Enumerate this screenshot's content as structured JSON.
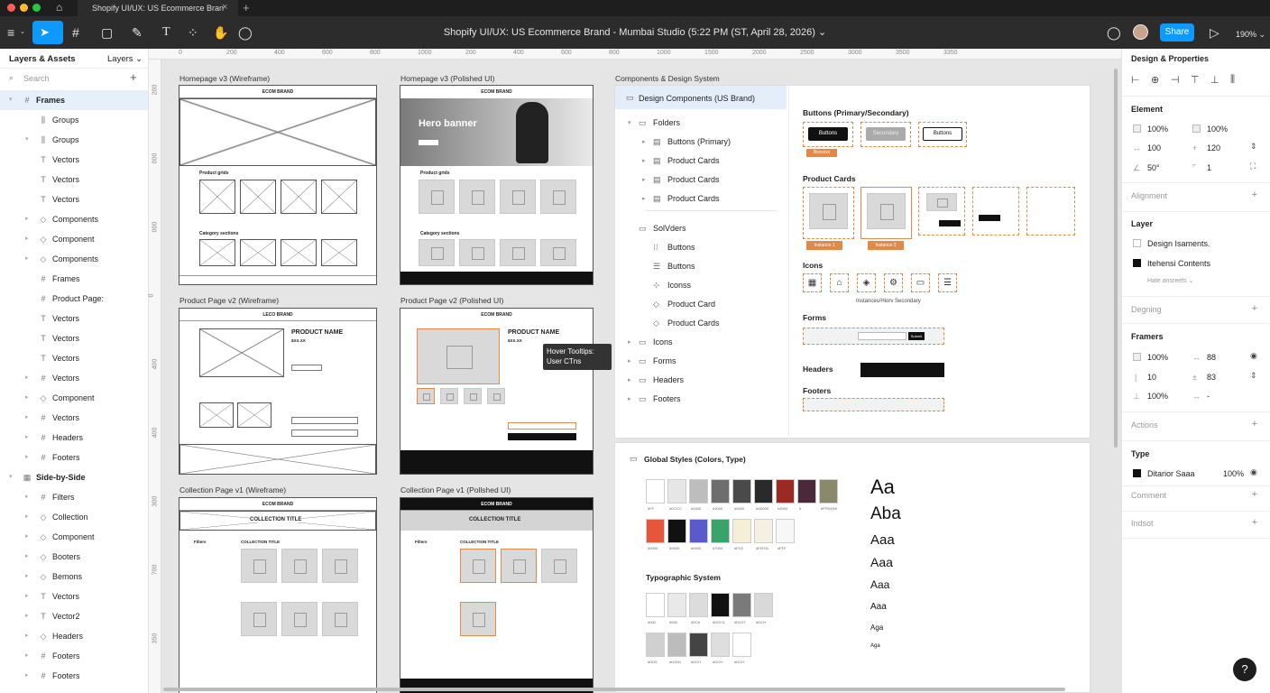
{
  "window": {
    "tab_title": "Shopify UI/UX: US Ecommerce Bran",
    "close": "×",
    "new_tab": "+"
  },
  "toolbar": {
    "doc_title": "Shopify UI/UX: US Ecommerce Brand - Mumbai Studio (5:22 PM (ST, April 28, 2026) ⌄",
    "share_label": "Share",
    "zoom_label": "190% ⌄"
  },
  "left_panel": {
    "tab_layers": "Layers & Assets",
    "tab_pages": "Layers ⌄",
    "search_placeholder": "Search",
    "items": [
      {
        "label": "Frames",
        "icon": "#",
        "indent": 0,
        "arrow": "▾",
        "bold": true
      },
      {
        "label": "Groups",
        "icon": "⫼",
        "indent": 2,
        "arrow": ""
      },
      {
        "label": "Groups",
        "icon": "⫼",
        "indent": 2,
        "arrow": "▾"
      },
      {
        "label": "Vectors",
        "icon": "T",
        "indent": 2,
        "arrow": ""
      },
      {
        "label": "Vectors",
        "icon": "T",
        "indent": 2,
        "arrow": ""
      },
      {
        "label": "Vectors",
        "icon": "T",
        "indent": 2,
        "arrow": ""
      },
      {
        "label": "Components",
        "icon": "◇",
        "indent": 2,
        "arrow": "▸"
      },
      {
        "label": "Component",
        "icon": "◇",
        "indent": 2,
        "arrow": "▸"
      },
      {
        "label": "Components",
        "icon": "◇",
        "indent": 2,
        "arrow": "▸"
      },
      {
        "label": "Frames",
        "icon": "#",
        "indent": 2,
        "arrow": ""
      },
      {
        "label": "Product Page:",
        "icon": "#",
        "indent": 2,
        "arrow": ""
      },
      {
        "label": "Vectors",
        "icon": "T",
        "indent": 2,
        "arrow": ""
      },
      {
        "label": "Vectors",
        "icon": "T",
        "indent": 2,
        "arrow": ""
      },
      {
        "label": "Vectors",
        "icon": "T",
        "indent": 2,
        "arrow": ""
      },
      {
        "label": "Vectors",
        "icon": "#",
        "indent": 2,
        "arrow": "▸"
      },
      {
        "label": "Component",
        "icon": "◇",
        "indent": 2,
        "arrow": "▸"
      },
      {
        "label": "Vectors",
        "icon": "#",
        "indent": 2,
        "arrow": "▸"
      },
      {
        "label": "Headers",
        "icon": "#",
        "indent": 2,
        "arrow": "▸"
      },
      {
        "label": "Footers",
        "icon": "#",
        "indent": 2,
        "arrow": "▸"
      },
      {
        "label": "Side-by-Side",
        "icon": "▦",
        "indent": 0,
        "arrow": "▾",
        "bold": true
      },
      {
        "label": "Filters",
        "icon": "#",
        "indent": 2,
        "arrow": "▸"
      },
      {
        "label": "Collection",
        "icon": "◇",
        "indent": 2,
        "arrow": "▸"
      },
      {
        "label": "Component",
        "icon": "◇",
        "indent": 2,
        "arrow": "▸"
      },
      {
        "label": "Booters",
        "icon": "◇",
        "indent": 2,
        "arrow": "▸"
      },
      {
        "label": "Bemons",
        "icon": "◇",
        "indent": 2,
        "arrow": "▸"
      },
      {
        "label": "Vectors",
        "icon": "T",
        "indent": 2,
        "arrow": "▸"
      },
      {
        "label": "Vector2",
        "icon": "T",
        "indent": 2,
        "arrow": "▸"
      },
      {
        "label": "Headers",
        "icon": "◇",
        "indent": 2,
        "arrow": "▸"
      },
      {
        "label": "Footers",
        "icon": "#",
        "indent": 2,
        "arrow": "▸"
      },
      {
        "label": "Footers",
        "icon": "#",
        "indent": 2,
        "arrow": "▸"
      }
    ]
  },
  "rulers": {
    "top": [
      "0",
      "200",
      "400",
      "600",
      "800",
      "1000",
      "200",
      "400",
      "600",
      "800",
      "1000",
      "1500",
      "2000",
      "2500",
      "3000",
      "3500",
      "3350"
    ],
    "left": [
      "200",
      "000",
      "000",
      "0",
      "400",
      "400",
      "300",
      "700",
      "350"
    ]
  },
  "frames": {
    "hp_wire": "Homepage v3 (Wireframe)",
    "hp_polish": "Homepage v3 (Polished UI)",
    "pp_wire": "Product Page v2 (Wireframe)",
    "pp_polish": "Product Page v2 (Polished UI)",
    "cp_wire": "Collection Page v1 (Wireframe)",
    "cp_polish": "Collection Page v1 (Pollshed UI)",
    "brand_wire": "ECOM BRAND",
    "brand_polish": "ECOM BRAND",
    "brand_pp": "LECO BRAND",
    "brand_ppp": "ECOM BRAND",
    "hero": "Hero banner",
    "grid_wire": "Product grids",
    "grid_polish": "Product grids",
    "cat_wire": "Category sections",
    "cat_polish": "Category sections",
    "product_name": "PRODUCT NAME",
    "price": "$XX.XX",
    "collection_title": "COLLECTION TITLE",
    "filters": "Filters",
    "tooltip": "Hover Tooltips: User CTns"
  },
  "components": {
    "panel_label": "Components & Design System",
    "root": "Design Components (US Brand)",
    "tree": [
      {
        "label": "Folders",
        "depth": 1,
        "arrow": "▾",
        "icon": "▭"
      },
      {
        "label": "Buttons (Primary)",
        "depth": 2,
        "arrow": "▸",
        "icon": "▤"
      },
      {
        "label": "Product Cards",
        "depth": 2,
        "arrow": "▸",
        "icon": "▤"
      },
      {
        "label": "Product Cards",
        "depth": 2,
        "arrow": "▸",
        "icon": "▤"
      },
      {
        "label": "Product Cards",
        "depth": 2,
        "arrow": "▸",
        "icon": "▤"
      },
      {
        "label": "SolVders",
        "depth": 1,
        "arrow": "",
        "icon": "▭"
      },
      {
        "label": "Buttons",
        "depth": 2,
        "arrow": "",
        "icon": "⁝⁝"
      },
      {
        "label": "Buttons",
        "depth": 2,
        "arrow": "",
        "icon": "☰"
      },
      {
        "label": "Iconss",
        "depth": 2,
        "arrow": "",
        "icon": "⊹"
      },
      {
        "label": "Product Card",
        "depth": 2,
        "arrow": "",
        "icon": "◇"
      },
      {
        "label": "Product Cards",
        "depth": 2,
        "arrow": "",
        "icon": "◇"
      },
      {
        "label": "Icons",
        "depth": 1,
        "arrow": "▸",
        "icon": "▭"
      },
      {
        "label": "Forms",
        "depth": 1,
        "arrow": "▸",
        "icon": "▭"
      },
      {
        "label": "Headers",
        "depth": 1,
        "arrow": "▸",
        "icon": "▭"
      },
      {
        "label": "Footers",
        "depth": 1,
        "arrow": "▸",
        "icon": "▭"
      }
    ],
    "buttons_title": "Buttons (Primary/Secondary)",
    "btn_primary": "Buttons",
    "btn_secondary": "Secondary",
    "btn_outline": "Buttons",
    "btn_tag": "Bxxxxxx",
    "cards_title": "Product Cards",
    "instance1": "Instance 1",
    "instance2": "Instance 2",
    "icons_title": "Icons",
    "icons_caption": "Instances/Hiorv Secondary",
    "forms_title": "Forms",
    "forms_btn": "Submit",
    "headers_title": "Headers",
    "footers_title": "Footers"
  },
  "global_styles": {
    "title": "Global Styles (Colors, Type)",
    "row1": [
      {
        "hex": "#ffffff",
        "l": "#FF"
      },
      {
        "hex": "#e6e6e6",
        "l": "#CCCC"
      },
      {
        "hex": "#bdbdbd",
        "l": "#2000"
      },
      {
        "hex": "#6e6e6e",
        "l": "#3000"
      },
      {
        "hex": "#4a4a4a",
        "l": "#0000"
      },
      {
        "hex": "#2a2a2a",
        "l": "#0D000"
      },
      {
        "hex": "#9a2a22",
        "l": "#3000"
      },
      {
        "hex": "#4a2a3a",
        "l": "#"
      },
      {
        "hex": "#8a8a6a",
        "l": "#FF00000"
      }
    ],
    "row2": [
      {
        "hex": "#e4573a",
        "l": "#0000"
      },
      {
        "hex": "#111111",
        "l": "#0000"
      },
      {
        "hex": "#5a5acc",
        "l": "#0000"
      },
      {
        "hex": "#3aa36a",
        "l": "#7000"
      },
      {
        "hex": "#f6efd8",
        "l": "#FCE"
      },
      {
        "hex": "#f5f0e3",
        "l": "#FFF00"
      },
      {
        "hex": "#f7f7f7",
        "l": "#FFF"
      }
    ],
    "typo_title": "Typographic System",
    "row3": [
      {
        "hex": "#ffffff",
        "l": "#000"
      },
      {
        "hex": "#e9e9e9",
        "l": "#000"
      },
      {
        "hex": "#dcdcdc",
        "l": "#DCh"
      },
      {
        "hex": "#111111",
        "l": "#DOC3"
      },
      {
        "hex": "#7a7a7a",
        "l": "#DO27"
      },
      {
        "hex": "#d9d9d9",
        "l": "#DCH"
      }
    ],
    "row4": [
      {
        "hex": "#d0d0d0",
        "l": "#DDS"
      },
      {
        "hex": "#bcbcbc",
        "l": "#DOhh"
      },
      {
        "hex": "#444444",
        "l": "#DCH"
      },
      {
        "hex": "#dedede",
        "l": "#DCH"
      },
      {
        "hex": "#ffffff",
        "l": "#DCH"
      }
    ],
    "type_samples": [
      "Aa",
      "Aba",
      "Aaa",
      "Aaa",
      "Aaa",
      "Aaa",
      "Aga",
      "Aga"
    ]
  },
  "right_panel": {
    "title": "Design & Properties",
    "element_title": "Element",
    "w": "100%",
    "h": "100%",
    "x": "100",
    "y": "120",
    "rot": "50°",
    "rad": "1",
    "alignment": "Alignment",
    "layer_title": "Layer",
    "layer1": "Design Isaments.",
    "layer2": "Itehensi Contents",
    "layer_more": "Hate ansreets ⌄",
    "degning": "Degning",
    "framers": "Framers",
    "fr1": "100%",
    "fr2": "88",
    "fr3": "10",
    "fr4": "83",
    "fr5": "100%",
    "fr6": "-",
    "actions": "Actions",
    "type_title": "Type",
    "type_name": "Ditarior Saaa",
    "type_pct": "100%",
    "comment": "Comment",
    "indsot": "Indsot"
  },
  "help": "?"
}
